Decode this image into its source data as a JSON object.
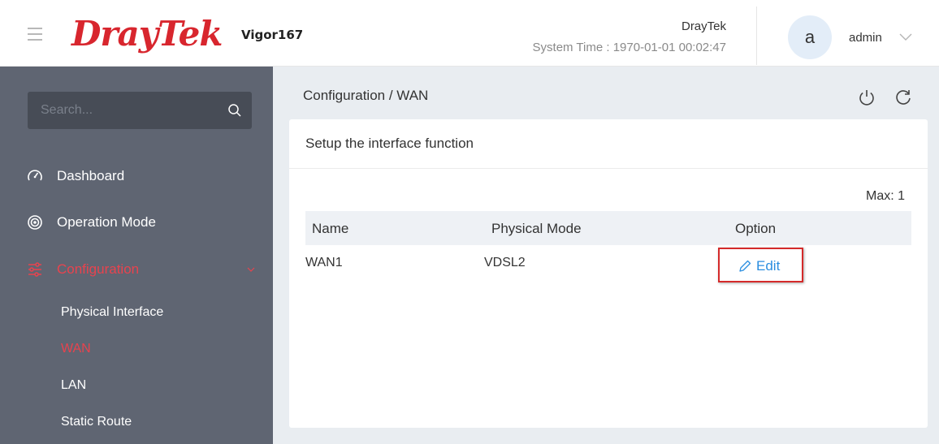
{
  "header": {
    "brand": "DrayTek",
    "model": "Vigor167",
    "device_name": "DrayTek",
    "system_time": "System Time : 1970-01-01 00:02:47",
    "avatar_letter": "a",
    "username": "admin"
  },
  "sidebar": {
    "search_placeholder": "Search...",
    "items": [
      {
        "label": "Dashboard",
        "icon": "gauge-icon"
      },
      {
        "label": "Operation Mode",
        "icon": "operation-mode-icon"
      },
      {
        "label": "Configuration",
        "icon": "sliders-icon",
        "active": true
      }
    ],
    "subitems": [
      {
        "label": "Physical Interface"
      },
      {
        "label": "WAN",
        "active": true
      },
      {
        "label": "LAN"
      },
      {
        "label": "Static Route"
      }
    ]
  },
  "main": {
    "breadcrumb": "Configuration / WAN",
    "card_title": "Setup the interface function",
    "max_label": "Max: 1",
    "columns": [
      "Name",
      "Physical Mode",
      "Option"
    ],
    "rows": [
      {
        "name": "WAN1",
        "physical_mode": "VDSL2",
        "option": "Edit"
      }
    ]
  },
  "colors": {
    "brand_red": "#d8262e",
    "sidebar_bg": "#5f6572",
    "active_red": "#e8434e",
    "link_blue": "#2b8ee0",
    "highlight_border": "#d42a2a"
  }
}
